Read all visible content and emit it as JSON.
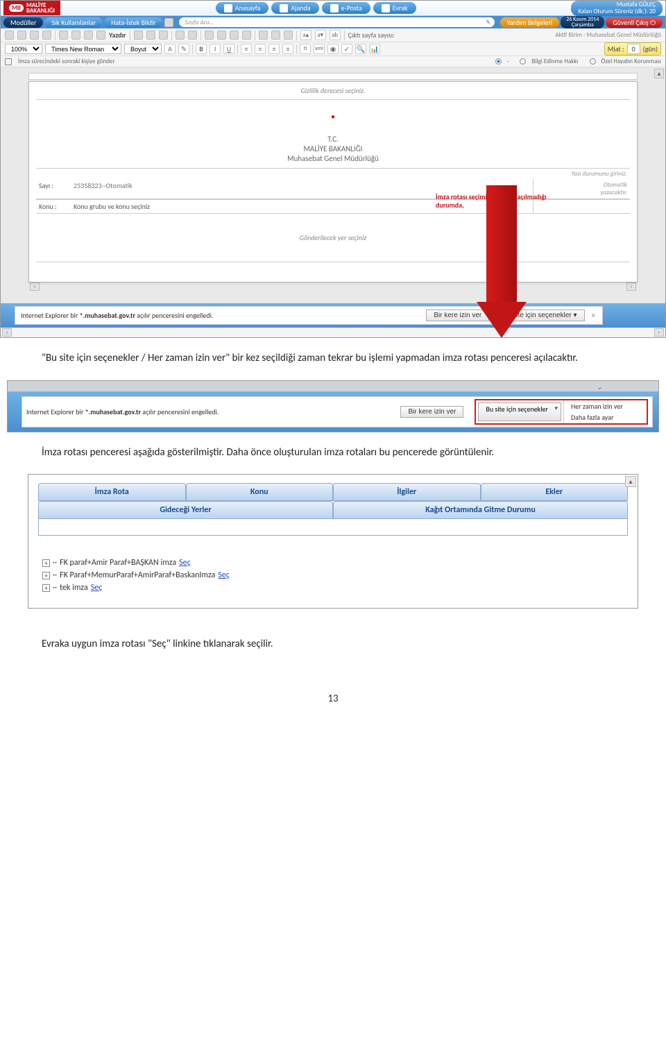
{
  "topbar": {
    "brand_badge": "MB",
    "brand_sub_top": "MALİYE",
    "brand_sub_bottom": "BAKANLIĞI",
    "tabs": [
      {
        "label": "Anasayfa"
      },
      {
        "label": "Ajanda"
      },
      {
        "label": "e-Posta"
      },
      {
        "label": "Evrak"
      }
    ],
    "user_name": "Mustafa GÜLEÇ",
    "user_sub": "Kalan Oturum Süreniz (dk.): 20"
  },
  "menubar": {
    "items": [
      "Modüller",
      "Sık Kullanılanlar",
      "Hata-İstek Bildir"
    ],
    "search_placeholder": "-Sayfa Ara...",
    "help": "Yardım Belgeleri",
    "date_top": "26 Kasım 2014",
    "date_bottom": "Çarşamba",
    "logout": "Güvenli Çıkış"
  },
  "toolbar": {
    "print": "Yazdır",
    "cikti_sayfa": "Çıktı sayfa sayısı:",
    "aktif": "Aktif Birim : Muhasebat Genel Müdürlüğü"
  },
  "format": {
    "zoom": "100%",
    "font": "Times New Roman",
    "size": "Boyut",
    "miat_label": "Miat :",
    "miat_value": "0",
    "miat_unit": "(gün)"
  },
  "options": {
    "send": "İmza sürecindeki sonraki kişiye gönder",
    "blank": "-",
    "bilgi": "Bilgi Edinme Hakkı",
    "ozel": "Özel Hayatın Korunması"
  },
  "doc": {
    "gizlilik": "Gizlilik derecesi seçiniz.",
    "tc": "T.C.",
    "bak": "MALİYE BAKANLIĞI",
    "mud": "Muhasebat Genel Müdürlüğü",
    "yazi_durumu": "Yazı durumunu giriniz.",
    "sayi_label": "Sayı  :",
    "sayi_value": "25358323--Otomatik",
    "sayi_right_top": "Otomatik",
    "sayi_right_bottom": "yazacaktır.",
    "konu_label": "Konu :",
    "konu_value": "Konu grubu ve konu seçiniz",
    "note": "İmza rotası seçimi ekranının açılmadığı durumda,",
    "gonder": "Gönderilecek yer seçiniz"
  },
  "iebar": {
    "msg": "Internet Explorer bir *.muhasebat.gov.tr açılır penceresini engelledi.",
    "btn_once": "Bir kere izin ver",
    "btn_opts": "Bu site için seçenekler ▾",
    "close": "×"
  },
  "para": {
    "p1": "\"Bu site için seçenekler / Her zaman izin ver\" bir kez seçildiği zaman tekrar bu işlemi yapmadan imza rotası penceresi açılacaktır.",
    "p2": "İmza rotası penceresi aşağıda gösterilmiştir. Daha önce oluşturulan imza rotaları bu pencerede görüntülenir.",
    "p3": "Evraka uygun imza rotası \"Seç\" linkine tıklanarak seçilir."
  },
  "bar2": {
    "msg": "Internet Explorer bir *.muhasebat.gov.tr açılır penceresini engelledi.",
    "btn_once": "Bir kere izin ver",
    "btn_opts": "Bu site için seçenekler",
    "menu_always": "Her zaman izin ver",
    "menu_more": "Daha fazla ayar"
  },
  "tabs": {
    "row1": [
      "İmza Rota",
      "Konu",
      "İlgiler",
      "Ekler"
    ],
    "row2": [
      "Gideceği Yerler",
      "Kağıt Ortamında Gitme Durumu"
    ]
  },
  "tree": {
    "items": [
      {
        "label": "FK paraf+Amir Paraf+BAŞKAN imza",
        "link": "Seç"
      },
      {
        "label": "FK Paraf+MemurParaf+AmirParaf+BaskanImza",
        "link": "Seç"
      },
      {
        "label": "tek imza",
        "link": "Seç"
      }
    ]
  },
  "page_number": "13"
}
